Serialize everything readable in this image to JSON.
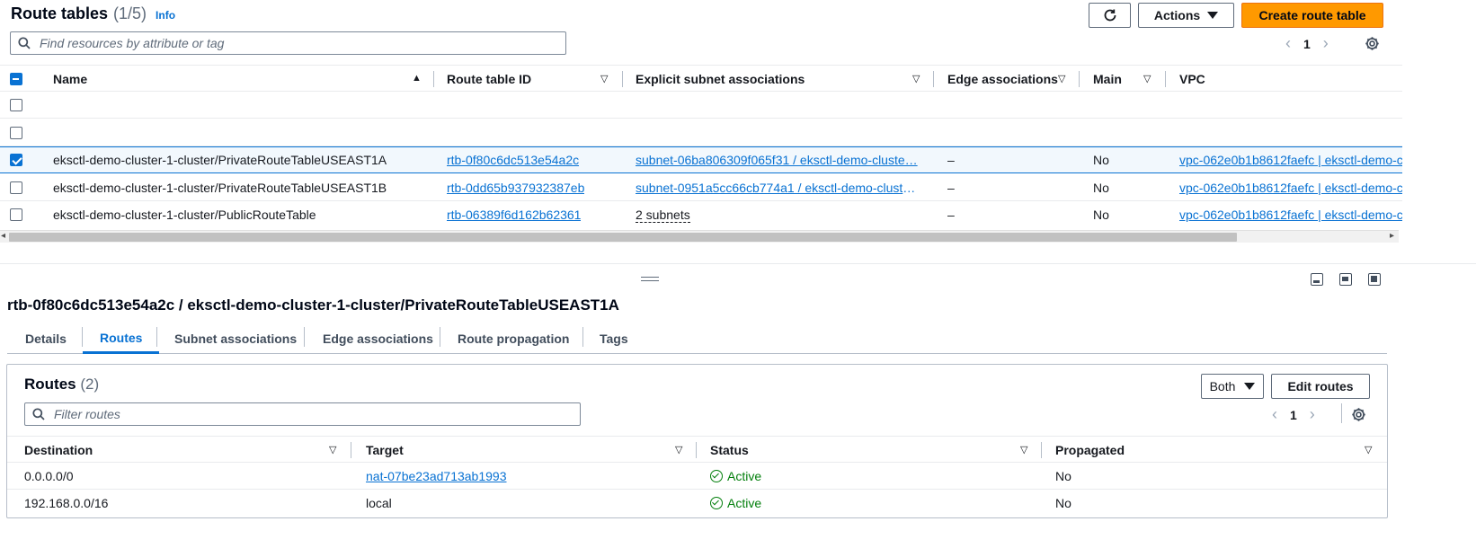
{
  "header": {
    "title": "Route tables",
    "count": "(1/5)",
    "info": "Info",
    "refresh_icon": "refresh-icon",
    "actions_label": "Actions",
    "create_label": "Create route table",
    "search_placeholder": "Find resources by attribute or tag",
    "page": "1"
  },
  "table": {
    "columns": [
      "Name",
      "Route table ID",
      "Explicit subnet associations",
      "Edge associations",
      "Main",
      "VPC"
    ],
    "rows": [
      {
        "name": "",
        "id": "",
        "subnets": "",
        "edge": "",
        "main": "",
        "vpc": "",
        "checked": false
      },
      {
        "name": "",
        "id": "",
        "subnets": "",
        "edge": "",
        "main": "",
        "vpc": "",
        "checked": false
      },
      {
        "name": "eksctl-demo-cluster-1-cluster/PrivateRouteTableUSEAST1A",
        "id": "rtb-0f80c6dc513e54a2c",
        "subnets": "subnet-06ba806309f065f31 / eksctl-demo-cluste…",
        "edge": "–",
        "main": "No",
        "vpc": "vpc-062e0b1b8612faefc | eksctl-demo-c",
        "checked": true
      },
      {
        "name": "eksctl-demo-cluster-1-cluster/PrivateRouteTableUSEAST1B",
        "id": "rtb-0dd65b937932387eb",
        "subnets": "subnet-0951a5cc66cb774a1 / eksctl-demo-cluste…",
        "edge": "–",
        "main": "No",
        "vpc": "vpc-062e0b1b8612faefc | eksctl-demo-c",
        "checked": false
      },
      {
        "name": "eksctl-demo-cluster-1-cluster/PublicRouteTable",
        "id": "rtb-06389f6d162b62361",
        "subnets": "2 subnets",
        "edge": "–",
        "main": "No",
        "vpc": "vpc-062e0b1b8612faefc | eksctl-demo-c",
        "checked": false
      }
    ]
  },
  "details": {
    "title": "rtb-0f80c6dc513e54a2c / eksctl-demo-cluster-1-cluster/PrivateRouteTableUSEAST1A",
    "tabs": [
      "Details",
      "Routes",
      "Subnet associations",
      "Edge associations",
      "Route propagation",
      "Tags"
    ],
    "active_tab": "Routes"
  },
  "routes": {
    "title": "Routes",
    "count": "(2)",
    "filter_label": "Both",
    "edit_label": "Edit routes",
    "search_placeholder": "Filter routes",
    "page": "1",
    "columns": [
      "Destination",
      "Target",
      "Status",
      "Propagated"
    ],
    "rows": [
      {
        "destination": "0.0.0.0/0",
        "target": "nat-07be23ad713ab1993",
        "status": "Active",
        "propagated": "No"
      },
      {
        "destination": "192.168.0.0/16",
        "target": "local",
        "status": "Active",
        "propagated": "No"
      }
    ]
  },
  "colors": {
    "primary": "#ff9900",
    "link": "#0972d3",
    "success": "#037f0c"
  }
}
